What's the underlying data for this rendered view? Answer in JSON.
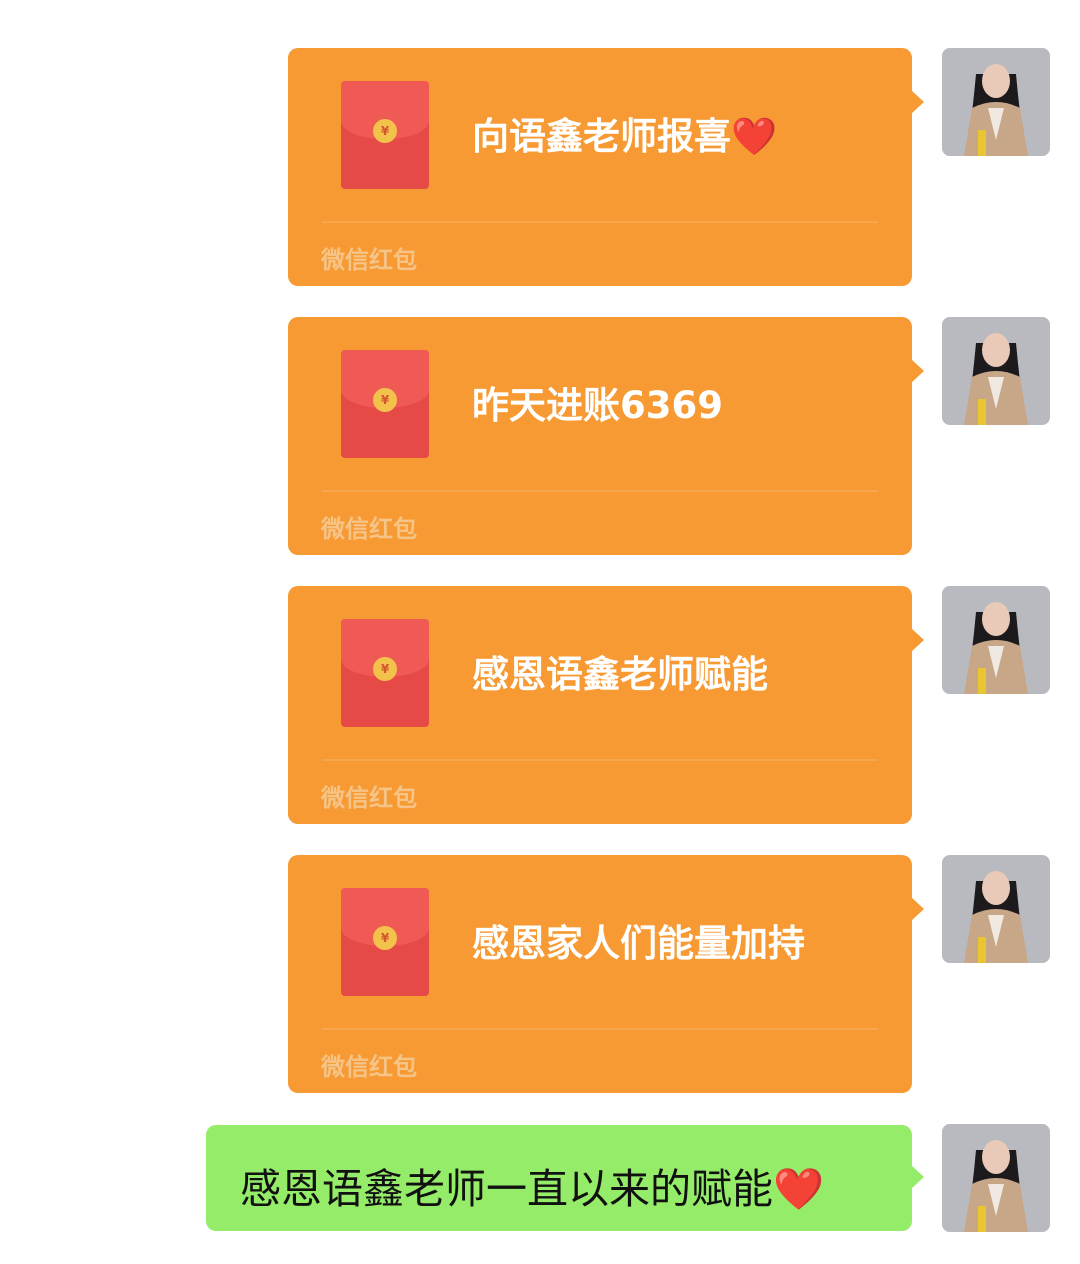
{
  "messages": [
    {
      "type": "red_packet",
      "title": "向语鑫老师报喜❤️",
      "footer": "微信红包",
      "coin_symbol": "¥"
    },
    {
      "type": "red_packet",
      "title": "昨天进账6369",
      "footer": "微信红包",
      "coin_symbol": "¥"
    },
    {
      "type": "red_packet",
      "title": "感恩语鑫老师赋能",
      "footer": "微信红包",
      "coin_symbol": "¥"
    },
    {
      "type": "red_packet",
      "title": "感恩家人们能量加持",
      "footer": "微信红包",
      "coin_symbol": "¥"
    },
    {
      "type": "text",
      "text": "感恩语鑫老师一直以来的赋能❤️"
    }
  ],
  "colors": {
    "red_packet_bubble": "#f79a34",
    "envelope": "#e64a47",
    "text_bubble": "#95ec69"
  }
}
